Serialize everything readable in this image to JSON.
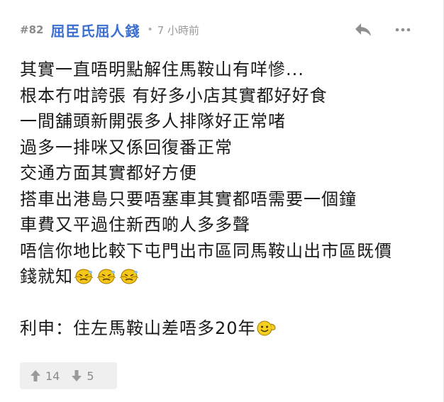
{
  "post": {
    "number": "#82",
    "username": "屈臣氏屈人錢",
    "separator": "•",
    "time": "7 小時前"
  },
  "content": {
    "lines": [
      "其實一直唔明點解住馬鞍山有咩慘...",
      "根本冇咁誇張 有好多小店其實都好好食",
      "一間舖頭新開張多人排隊好正常啫",
      "過多一排咪又係回復番正常",
      "交通方面其實都好方便",
      "搭車出港島只要唔塞車其實都唔需要一個鐘",
      "車費又平過住新西啲人多多聲",
      "唔信你地比較下屯門出市區同馬鞍山出市區既價",
      "錢就知"
    ],
    "last_line": "利申：住左馬鞍山差唔多20年"
  },
  "votes": {
    "up": "14",
    "down": "5"
  },
  "icons": {
    "reply": "reply-icon",
    "more": "more-icon",
    "upvote": "thumb-up-arrow-icon",
    "downvote": "thumb-down-arrow-icon",
    "emoji_sweat": "sweat-emoji-icon",
    "emoji_smile": "smile-emoji-icon"
  },
  "colors": {
    "username": "#3a6fd0",
    "meta": "#9a9a9a",
    "text": "#1a1a1a",
    "vote_bg": "#efefef"
  }
}
